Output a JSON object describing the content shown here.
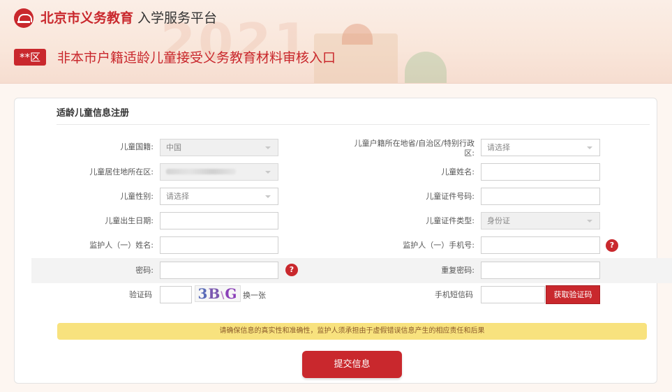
{
  "header": {
    "brand_strong": "北京市义务教育",
    "brand_light": "入学服务平台",
    "watermark": "2021",
    "district_badge": "**区",
    "page_title": "非本市户籍适龄儿童接受义务教育材料审核入口"
  },
  "form": {
    "title": "适龄儿童信息注册",
    "nationality": {
      "label": "儿童国籍:",
      "value": "中国"
    },
    "residence_district": {
      "label": "儿童居住地所在区:"
    },
    "gender": {
      "label": "儿童性别:",
      "placeholder": "请选择"
    },
    "birth_date": {
      "label": "儿童出生日期:"
    },
    "guardian_name": {
      "label": "监护人（一）姓名:"
    },
    "password": {
      "label": "密码:"
    },
    "captcha": {
      "label": "验证码",
      "image_text": [
        "3",
        "B",
        "\\",
        "G"
      ],
      "swap_label": "换一张"
    },
    "household_province": {
      "label_line1": "儿童户籍所在地省/自治区/特别行政",
      "label_line2": "区:",
      "placeholder": "请选择"
    },
    "child_name": {
      "label": "儿童姓名:"
    },
    "id_number": {
      "label": "儿童证件号码:"
    },
    "id_type": {
      "label": "儿童证件类型:",
      "value": "身份证"
    },
    "guardian_phone": {
      "label": "监护人（一）手机号:"
    },
    "repeat_password": {
      "label": "重复密码:"
    },
    "sms_code": {
      "label": "手机短信码",
      "button": "获取验证码"
    },
    "help_symbol": "?"
  },
  "notice": "请确保信息的真实性和准确性，监护人须承担由于虚假错误信息产生的相应责任和后果",
  "submit_label": "提交信息",
  "colors": {
    "accent": "#c9282d",
    "notice_bg": "#f8e27e"
  }
}
